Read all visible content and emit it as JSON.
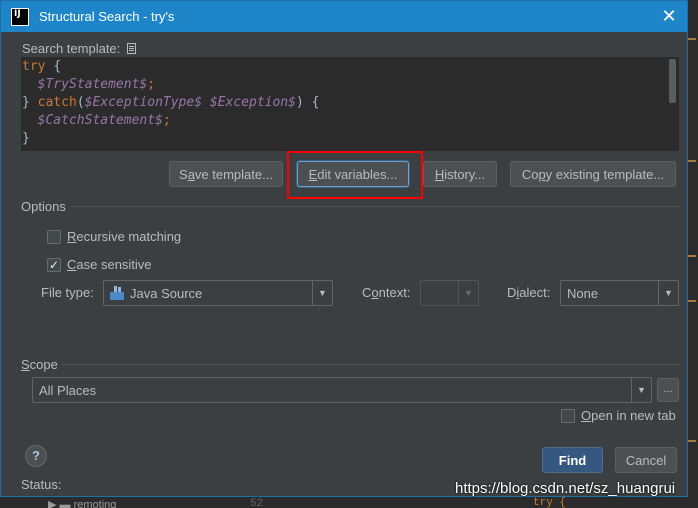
{
  "window": {
    "title": "Structural Search - try's",
    "app_icon_text": "IJ"
  },
  "search_template": {
    "label": "Search template:",
    "code_lines": [
      [
        {
          "t": "try ",
          "c": "kw"
        },
        {
          "t": "{",
          "c": "plain"
        }
      ],
      [
        {
          "t": "  ",
          "c": "plain"
        },
        {
          "t": "$TryStatement$",
          "c": "var"
        },
        {
          "t": ";",
          "c": "kw"
        }
      ],
      [
        {
          "t": "} ",
          "c": "plain"
        },
        {
          "t": "catch",
          "c": "kw"
        },
        {
          "t": "(",
          "c": "plain"
        },
        {
          "t": "$ExceptionType$",
          "c": "var"
        },
        {
          "t": " ",
          "c": "plain"
        },
        {
          "t": "$Exception$",
          "c": "var"
        },
        {
          "t": ") {",
          "c": "plain"
        }
      ],
      [
        {
          "t": "  ",
          "c": "plain"
        },
        {
          "t": "$CatchStatement$",
          "c": "var"
        },
        {
          "t": ";",
          "c": "kw"
        }
      ],
      [
        {
          "t": "}",
          "c": "plain"
        }
      ]
    ]
  },
  "buttons": {
    "save_template": "Save template...",
    "edit_variables": "Edit variables...",
    "history": "History...",
    "copy_existing_template": "Copy existing template..."
  },
  "options": {
    "label": "Options",
    "recursive_matching": {
      "label": "Recursive matching",
      "checked": false
    },
    "case_sensitive": {
      "label": "Case sensitive",
      "checked": true
    },
    "file_type_label": "File type:",
    "file_type_value": "Java Source",
    "context_label": "Context:",
    "context_value": "",
    "dialect_label": "Dialect:",
    "dialect_value": "None"
  },
  "scope": {
    "label": "Scope",
    "value": "All Places",
    "ellipsis": "...",
    "open_in_new_tab": {
      "label": "Open in new tab",
      "checked": false
    }
  },
  "footer": {
    "help": "?",
    "find": "Find",
    "cancel": "Cancel",
    "status_label": "Status:"
  },
  "background": {
    "tree_item": "remoting",
    "line_number": "52",
    "code_fragment": "try {"
  },
  "watermark": "https://blog.csdn.net/sz_huangrui",
  "colors": {
    "titlebar": "#1e86c8",
    "dialog_bg": "#3c3f41",
    "editor_bg": "#2b2b2b",
    "keyword": "#cc7832",
    "variable": "#9876aa",
    "primary_button": "#365880",
    "highlight_box": "#ff0000"
  }
}
